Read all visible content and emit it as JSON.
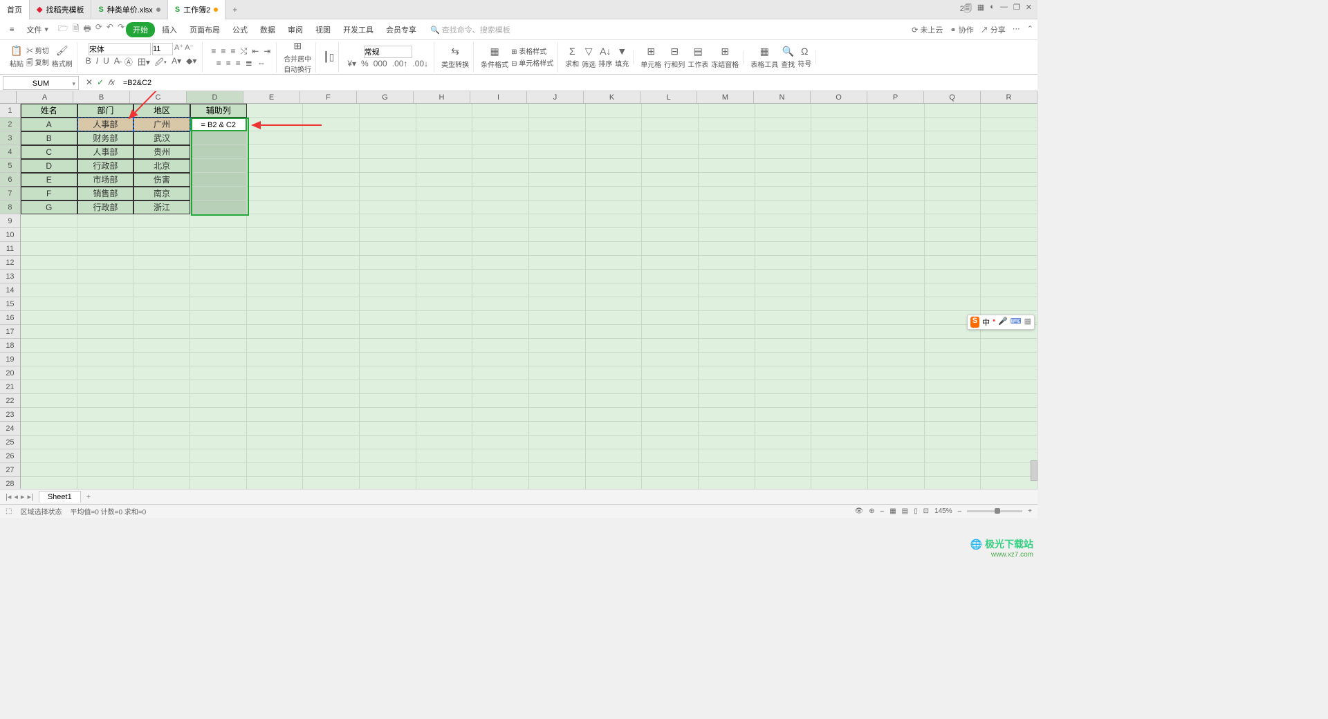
{
  "tabs": {
    "home": "首页",
    "items": [
      {
        "icon_color": "#d23",
        "label": "找稻壳模板",
        "dot": ""
      },
      {
        "icon_color": "#22a637",
        "label": "种类单价.xlsx",
        "dot": "#888"
      },
      {
        "icon_color": "#22a637",
        "label": "工作簿2",
        "dot": "#f90"
      }
    ]
  },
  "window_icons": {
    "badge1": "2🗐",
    "grid": "▦",
    "user": "◐",
    "min": "—",
    "max": "❐",
    "close": "✕"
  },
  "menu": {
    "hamburger": "≡",
    "file": "文件",
    "qa": [
      "🗁",
      "🗎",
      "🖶",
      "⟳",
      "↶",
      "↷"
    ],
    "items": [
      "开始",
      "插入",
      "页面布局",
      "公式",
      "数据",
      "审阅",
      "视图",
      "开发工具",
      "会员专享"
    ],
    "search_icon": "🔍",
    "search_hint": "查找命令、搜索模板",
    "right": {
      "cloud": "⟳ 未上云",
      "coop": "⚭ 协作",
      "share": "↗ 分享",
      "more": "⋯",
      "expand": "⌃"
    }
  },
  "ribbon": {
    "paste": {
      "label": "粘贴",
      "cut": "✂ 剪切",
      "copy": "🗐 复制",
      "brush_label": "格式刷"
    },
    "font": {
      "name": "宋体",
      "size": "11"
    },
    "font_btns": [
      "B",
      "I",
      "U",
      "A̶",
      "Ⓐ",
      "田▾",
      "🖉▾",
      "A▾",
      "◆▾"
    ],
    "font_grow": [
      "A⁺",
      "A⁻"
    ],
    "align_btns": [
      "≡̄",
      "≡",
      "≡̲",
      "≡",
      "≡",
      "≡",
      "≡̲",
      "⇄",
      "≡"
    ],
    "merge": {
      "label": "合并居中",
      "wrap": "自动换行"
    },
    "pane": {
      "label": "┃▯"
    },
    "number": {
      "format": "常规",
      "btns": [
        "¥▾",
        "%",
        "000",
        ".00↑",
        ".00↓"
      ],
      "type_conv": "类型转换"
    },
    "cond": {
      "label": "条件格式",
      "table_style": "⊞ 表格样式",
      "cell_style": "⊟ 单元格样式"
    },
    "calc": {
      "sum": "求和",
      "filter": "筛选",
      "sort": "排序",
      "fill": "填充"
    },
    "cells": {
      "cell": "单元格",
      "rowcol": "行和列",
      "sheet": "工作表",
      "freeze": "冻结窗格"
    },
    "tools": {
      "tool": "表格工具",
      "find": "查找",
      "symbol": "符号"
    }
  },
  "formula": {
    "name_box": "SUM",
    "cancel": "✕",
    "accept": "✓",
    "fx": "𝑓x",
    "value": "=B2&C2"
  },
  "columns": [
    "A",
    "B",
    "C",
    "D",
    "E",
    "F",
    "G",
    "H",
    "I",
    "J",
    "K",
    "L",
    "M",
    "N",
    "O",
    "P",
    "Q",
    "R"
  ],
  "row_count": 30,
  "grid": {
    "headers": [
      "姓名",
      "部门",
      "地区",
      "辅助列"
    ],
    "rows": [
      {
        "a": "A",
        "b": "人事部",
        "c": "广州"
      },
      {
        "a": "B",
        "b": "财务部",
        "c": "武汉"
      },
      {
        "a": "C",
        "b": "人事部",
        "c": "贵州"
      },
      {
        "a": "D",
        "b": "行政部",
        "c": "北京"
      },
      {
        "a": "E",
        "b": "市场部",
        "c": "伤害"
      },
      {
        "a": "F",
        "b": "销售部",
        "c": "南京"
      },
      {
        "a": "G",
        "b": "行政部",
        "c": "浙江"
      }
    ],
    "edit_cell": "= B2 & C2"
  },
  "sheet": {
    "nav": [
      "|◂",
      "◂",
      "▸",
      "▸|"
    ],
    "name": "Sheet1",
    "add": "+"
  },
  "status": {
    "icon": "⬚",
    "mode": "区域选择状态",
    "stats": "平均值=0  计数=0  求和=0",
    "right_icons": [
      "👁",
      "⊕",
      "–",
      "▦",
      "▤",
      "▯",
      "⊡"
    ],
    "zoom": "145%",
    "minus": "–",
    "plus": "+"
  },
  "ime": {
    "s": "S",
    "lang": "中",
    "dot": "•",
    "mic": "🎤",
    "kb": "⌨",
    "grid": "▦"
  },
  "watermark": {
    "name": "极光下载站",
    "url": "www.xz7.com"
  }
}
